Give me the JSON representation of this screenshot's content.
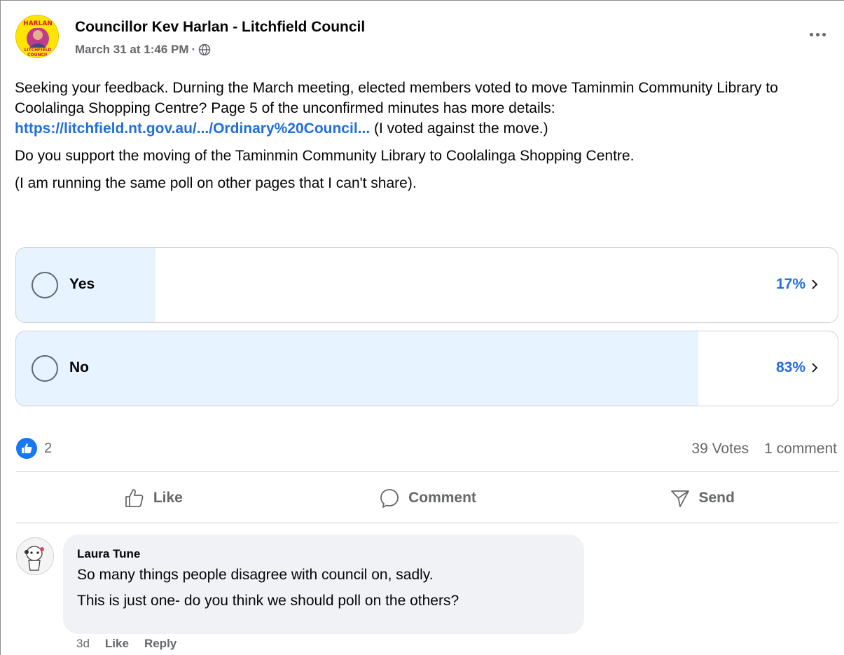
{
  "post": {
    "author": "Councillor Kev Harlan - Litchfield Council",
    "timestamp": "March 31 at 1:46 PM",
    "separator": "·",
    "privacy_icon": "globe-icon",
    "avatar_text_top": "HARLAN",
    "avatar_text_bottom": "LITCHFIELD COUNCIL",
    "paragraph1_text": "Seeking your feedback. Durning the March meeting, elected members voted to move  Taminmin Community Library to Coolalinga Shopping Centre? Page 5 of the unconfirmed minutes has more details: ",
    "paragraph1_link": "https://litchfield.nt.gov.au/.../Ordinary%20Council...",
    "paragraph1_after": " (I voted against the move.)",
    "paragraph2": "Do you support the moving of the Taminmin Community Library to Coolalinga Shopping Centre.",
    "paragraph3": "(I am running the same poll on other pages that I can't share)."
  },
  "poll": {
    "options": [
      {
        "label": "Yes",
        "percent_text": "17%",
        "fraction": 0.17
      },
      {
        "label": "No",
        "percent_text": "83%",
        "fraction": 0.83
      }
    ]
  },
  "engagement": {
    "reaction_icon": "thumbs-up-icon",
    "reaction_count": "2",
    "votes": "39 Votes",
    "comments": "1 comment"
  },
  "actions": {
    "like": "Like",
    "comment": "Comment",
    "send": "Send"
  },
  "comment": {
    "author": "Laura Tune",
    "line1": "So many things people disagree with council on, sadly.",
    "line2": "This is just one- do you think we should poll on the others?",
    "age": "3d",
    "like": "Like",
    "reply": "Reply"
  },
  "colors": {
    "accent": "#216fdb",
    "poll_fill": "#e7f3ff",
    "muted": "#65676b",
    "like_blue": "#1877f2"
  }
}
